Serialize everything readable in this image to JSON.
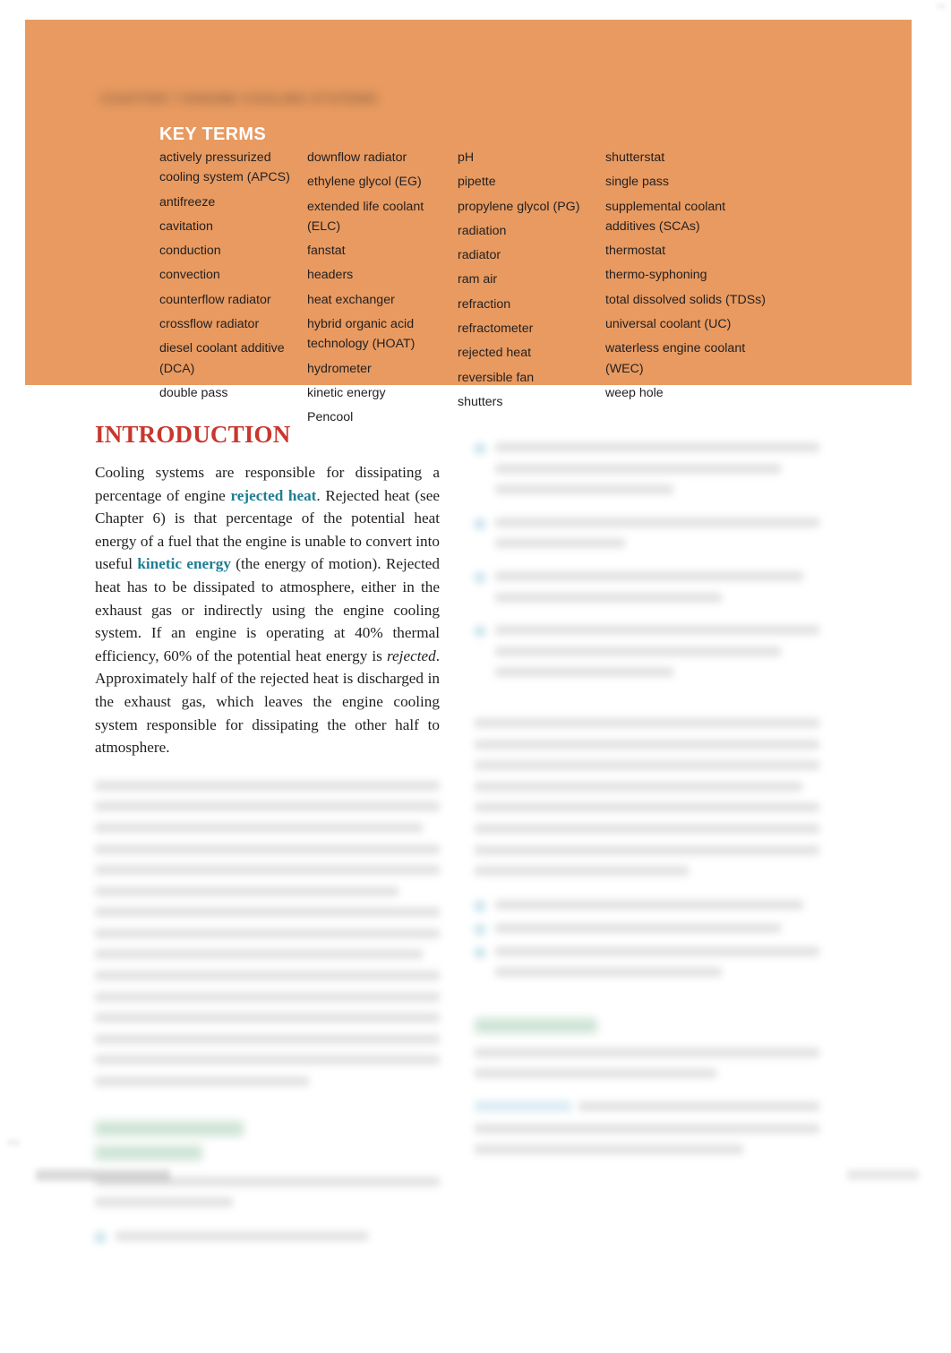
{
  "document": {
    "page_background": "#ffffff",
    "text_color": "#231f20"
  },
  "key_terms_panel": {
    "background_color": "#e89a60",
    "running_head": "CHAPTER 7  ENGINE COOLING SYSTEMS",
    "running_head_legible": false,
    "title": "KEY TERMS",
    "title_color": "#ffffff",
    "columns": [
      {
        "terms": [
          "actively pressurized cooling system (APCS)",
          "antifreeze",
          "cavitation",
          "conduction",
          "convection",
          "counterflow radiator",
          "crossflow radiator",
          "diesel coolant additive (DCA)",
          "double pass"
        ]
      },
      {
        "terms": [
          "downflow radiator",
          "ethylene glycol (EG)",
          "extended life coolant (ELC)",
          "fanstat",
          "headers",
          "heat exchanger",
          "hybrid organic acid technology (HOAT)",
          "hydrometer",
          "kinetic energy",
          "Pencool"
        ]
      },
      {
        "terms": [
          "pH",
          "pipette",
          "propylene glycol (PG)",
          "radiation",
          "radiator",
          "ram air",
          "refraction",
          "refractometer",
          "rejected heat",
          "reversible fan",
          "shutters"
        ]
      },
      {
        "terms": [
          "shutterstat",
          "single pass",
          "supplemental coolant additives (SCAs)",
          "thermostat",
          "thermo-syphoning",
          "total dissolved solids (TDSs)",
          "universal coolant (UC)",
          "waterless engine coolant (WEC)",
          "weep hole"
        ]
      }
    ]
  },
  "introduction": {
    "heading": "INTRODUCTION",
    "heading_color": "#c8372d",
    "paragraph_parts": {
      "p1": "Cooling systems are responsible for dissipating a percentage of engine ",
      "term1": "rejected heat",
      "p2": ". Rejected heat (see Chapter 6) is that percentage of the potential heat energy of a fuel that the engine is unable to convert into useful ",
      "term2": "kinetic energy",
      "p3": " (the energy of motion). Rejected heat has to be dissipated to atmosphere, either in the exhaust gas or indirectly using the engine cooling system. If an engine is operating at 40% thermal efficiency, 60% of the potential heat energy is ",
      "term3_italic": "rejected",
      "p4": ". Approximately half of the rejected heat is discharged in the exhaust gas, which leaves the engine cooling system responsible for dissipating the other half to atmosphere."
    },
    "term_link_color": "#1c7f94"
  },
  "left_column_lower": {
    "blurred_paragraph_legible": false,
    "green_heading_legible": false,
    "green_heading_color": "#5fa877",
    "green_heading_lines": 2,
    "bullet_marker_color": "#8fc6d8"
  },
  "right_column": {
    "blurred_list_legible": false,
    "green_heading_legible": false,
    "green_heading_color": "#5fa877",
    "green_heading_lines": 1,
    "teal_highlight_color": "#bcdcea",
    "bullet_marker_color": "#8fc6d8"
  },
  "footer": {
    "left_text_legible": false,
    "right_text_legible": false
  }
}
